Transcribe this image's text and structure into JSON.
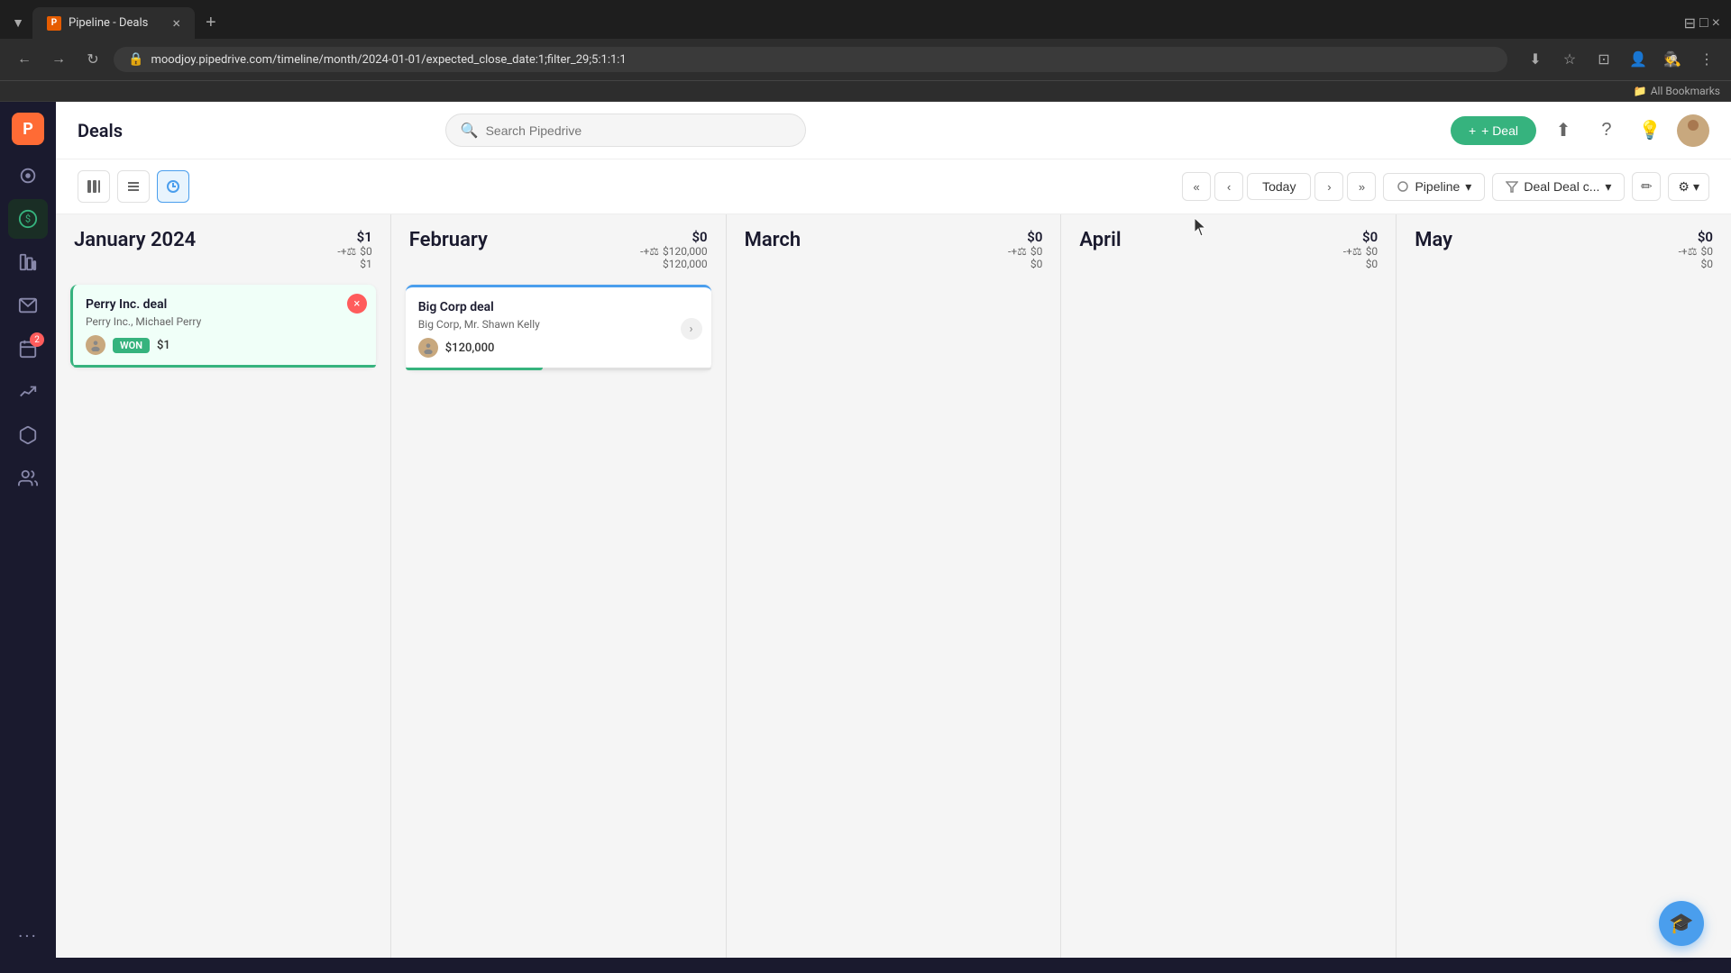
{
  "browser": {
    "tab_title": "Pipeline - Deals",
    "tab_favicon": "P",
    "url": "moodjoy.pipedrive.com/timeline/month/2024-01-01/expected_close_date:1;filter_29;5:1:1:1",
    "incognito_label": "Incognito",
    "bookmarks_label": "All Bookmarks"
  },
  "app": {
    "title": "Deals",
    "search_placeholder": "Search Pipedrive",
    "add_deal_label": "+ Deal"
  },
  "toolbar": {
    "today_label": "Today",
    "pipeline_label": "Pipeline",
    "deal_filter_label": "Deal Deal c..."
  },
  "timeline": {
    "months": [
      {
        "name": "January 2024",
        "amount_right": "$1",
        "balance_label": "-+⚖",
        "stat1": "$0",
        "stat2": "$1",
        "deals": [
          {
            "id": "perry-inc",
            "title": "Perry Inc. deal",
            "subtitle": "Perry Inc., Michael Perry",
            "type": "won",
            "badge": "WON",
            "value": "$1",
            "progress": 100,
            "has_cancel": true
          }
        ]
      },
      {
        "name": "February",
        "amount_right": "$0",
        "balance_label": "-+⚖",
        "stat1": "$120,000",
        "stat2": "$120,000",
        "deals": [
          {
            "id": "big-corp",
            "title": "Big Corp deal",
            "subtitle": "Big Corp, Mr. Shawn Kelly",
            "type": "pipeline",
            "badge": null,
            "value": "$120,000",
            "progress": 45,
            "has_cancel": false,
            "has_arrow": true,
            "has_top_bar": true
          }
        ]
      },
      {
        "name": "March",
        "amount_right": "$0",
        "balance_label": "-+⚖",
        "stat1": "$0",
        "stat2": "$0",
        "deals": []
      },
      {
        "name": "April",
        "amount_right": "$0",
        "balance_label": "-+⚖",
        "stat1": "$0",
        "stat2": "$0",
        "deals": []
      },
      {
        "name": "May",
        "amount_right": "$0",
        "balance_label": "-+⚖",
        "stat1": "$0",
        "stat2": "$0",
        "deals": []
      }
    ]
  },
  "sidebar": {
    "items": [
      {
        "icon": "target-icon",
        "label": "Activity",
        "active": false
      },
      {
        "icon": "deals-icon",
        "label": "Deals",
        "active": true
      },
      {
        "icon": "leads-icon",
        "label": "Leads",
        "active": false
      },
      {
        "icon": "mail-icon",
        "label": "Mail",
        "active": false
      },
      {
        "icon": "calendar-icon",
        "label": "Calendar",
        "active": false,
        "badge": "2"
      },
      {
        "icon": "chart-icon",
        "label": "Reports",
        "active": false
      },
      {
        "icon": "products-icon",
        "label": "Products",
        "active": false
      },
      {
        "icon": "contacts-icon",
        "label": "Contacts",
        "active": false
      }
    ]
  },
  "help_fab": "🎓"
}
